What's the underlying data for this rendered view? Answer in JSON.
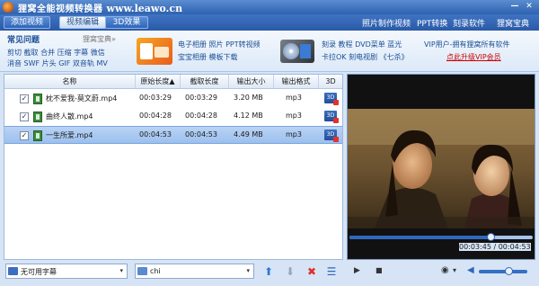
{
  "window": {
    "title_cn": "狸窝全能视频转换器",
    "title_url": "www.leawo.cn",
    "minimize_glyph": "—",
    "close_glyph": "✕"
  },
  "tabs": [
    {
      "label": "添加视频",
      "active": false
    },
    {
      "label": "视频编辑",
      "active": true
    },
    {
      "label": "3D效果",
      "active": false
    }
  ],
  "top_menu": [
    "照片制作视频",
    "PPT转换",
    "刻录软件",
    "狸窝宝典"
  ],
  "banner": {
    "faq_title": "常见问题",
    "faq_more": "狸窝宝典»",
    "faq_lines": [
      "剪切 截取 合并 压缩 字幕 微信",
      "消音 SWF 片头 GIF 双音轨 MV"
    ],
    "promo1_lines": [
      "电子相册 照片 PPT转视频",
      "宝宝相册 模板下载"
    ],
    "promo2_lines": [
      "刻录 教程 DVD菜单 蓝光",
      "卡拉OK 刻电视剧 《七杀》"
    ],
    "vip_line1": "VIP用户-拥有狸窝所有软件",
    "vip_line2": "点此升级VIP会员",
    "colors": {
      "vip_link": "#cc0000",
      "text_blue": "#1b4e95"
    }
  },
  "file_list": {
    "columns": [
      "名称",
      "原始长度▲",
      "截取长度",
      "输出大小",
      "输出格式",
      "3D"
    ],
    "rows": [
      {
        "checked": true,
        "name": "枕不爱我-莫文蔚.mp4",
        "original_length": "00:03:29",
        "clip_length": "00:03:29",
        "output_size": "3.20 MB",
        "output_format": "mp3",
        "selected": false
      },
      {
        "checked": true,
        "name": "曲终人散.mp4",
        "original_length": "00:04:28",
        "clip_length": "00:04:28",
        "output_size": "4.12 MB",
        "output_format": "mp3",
        "selected": false
      },
      {
        "checked": true,
        "name": "一生所爱.mp4",
        "original_length": "00:04:53",
        "clip_length": "00:04:53",
        "output_size": "4.49 MB",
        "output_format": "mp3",
        "selected": true
      }
    ],
    "checkbox_glyph": "✓",
    "icon_3d_text": "3D"
  },
  "player": {
    "time_current": "00:03:45",
    "time_total": "00:04:53",
    "time_separator": " / ",
    "progress_fraction": 0.768,
    "volume_fraction": 0.62,
    "play_glyph": "▶",
    "stop_glyph": "■",
    "camera_glyph": "◉",
    "camera_arrow_glyph": "▾",
    "speaker_glyph": "◀"
  },
  "bottom": {
    "subtitle_value": "无可用字幕",
    "audio_value": "chi",
    "arrow_glyph": "▾",
    "move_up_glyph": "⬆",
    "move_down_glyph": "⬇",
    "delete_glyph": "✖",
    "list_glyph": "☰"
  }
}
